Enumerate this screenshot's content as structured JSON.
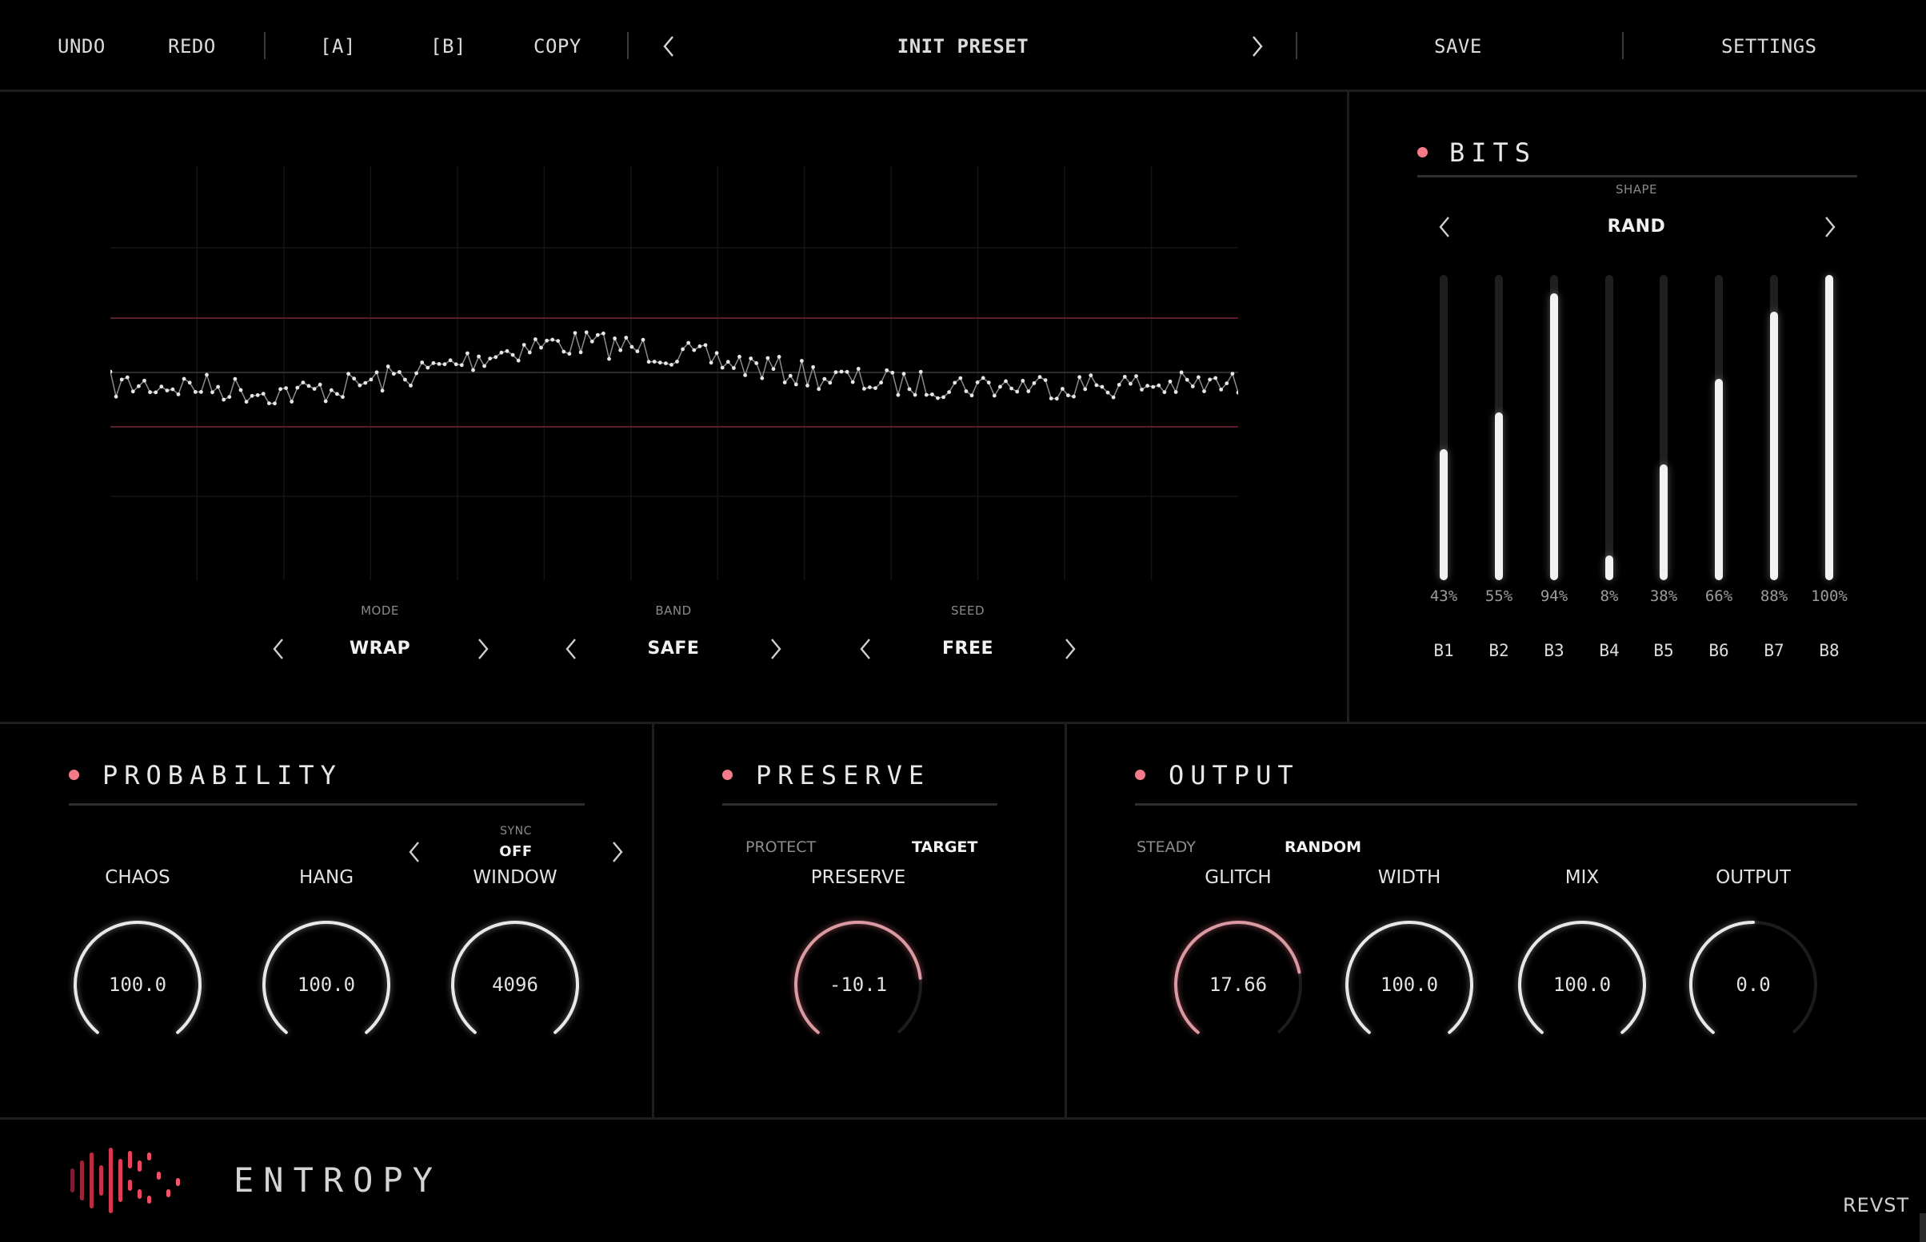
{
  "toolbar": {
    "undo": "UNDO",
    "redo": "REDO",
    "slot_a": "[A]",
    "slot_b": "[B]",
    "copy": "COPY",
    "preset_name": "INIT PRESET",
    "save": "SAVE",
    "settings": "SETTINGS"
  },
  "scope": {
    "mode": {
      "caption": "MODE",
      "value": "WRAP"
    },
    "band": {
      "caption": "BAND",
      "value": "SAFE"
    },
    "seed": {
      "caption": "SEED",
      "value": "FREE"
    }
  },
  "bits": {
    "title": "BITS",
    "shape_caption": "SHAPE",
    "shape_value": "RAND",
    "bars": [
      {
        "label": "B1",
        "percent_text": "43%",
        "level": 0.43
      },
      {
        "label": "B2",
        "percent_text": "55%",
        "level": 0.55
      },
      {
        "label": "B3",
        "percent_text": "94%",
        "level": 0.94
      },
      {
        "label": "B4",
        "percent_text": "8%",
        "level": 0.08
      },
      {
        "label": "B5",
        "percent_text": "38%",
        "level": 0.38
      },
      {
        "label": "B6",
        "percent_text": "66%",
        "level": 0.66
      },
      {
        "label": "B7",
        "percent_text": "88%",
        "level": 0.88
      },
      {
        "label": "B8",
        "percent_text": "100%",
        "level": 1.0
      }
    ]
  },
  "probability": {
    "title": "PROBABILITY",
    "sync_caption": "SYNC",
    "sync_value": "OFF",
    "knobs": [
      {
        "label": "CHAOS",
        "value": "100.0",
        "level": 1.0
      },
      {
        "label": "HANG",
        "value": "100.0",
        "level": 1.0
      },
      {
        "label": "WINDOW",
        "value": "4096",
        "level": 1.0
      }
    ]
  },
  "preserve": {
    "title": "PRESERVE",
    "option_protect": "PROTECT",
    "option_target": "TARGET",
    "knob": {
      "label": "PRESERVE",
      "value": "-10.1",
      "level": 0.8
    }
  },
  "output": {
    "title": "OUTPUT",
    "option_steady": "STEADY",
    "option_random": "RANDOM",
    "knobs": [
      {
        "label": "GLITCH",
        "value": "17.66",
        "level": 0.78,
        "accent": true
      },
      {
        "label": "WIDTH",
        "value": "100.0",
        "level": 1.0,
        "accent": false
      },
      {
        "label": "MIX",
        "value": "100.0",
        "level": 1.0,
        "accent": false
      },
      {
        "label": "OUTPUT",
        "value": "0.0",
        "level": 0.5,
        "accent": false
      }
    ]
  },
  "footer": {
    "product_name": "ENTROPY",
    "brand": "REVST"
  },
  "colors": {
    "accent": "#f47a8a",
    "accent_dark": "#b8384f",
    "background": "#000000",
    "panel_border": "#1e1e1e"
  }
}
